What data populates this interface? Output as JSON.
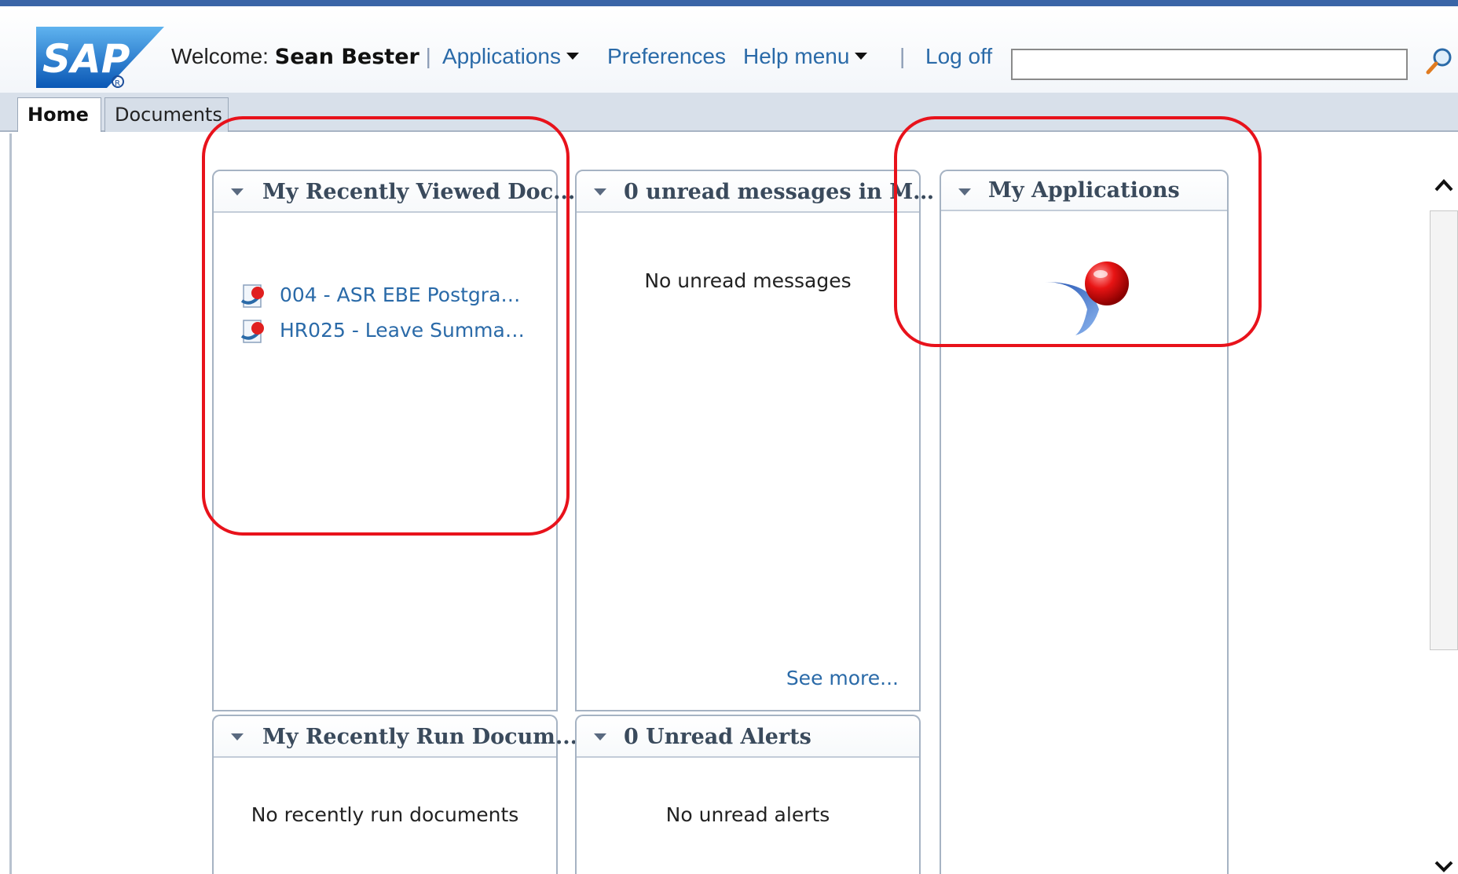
{
  "header": {
    "logo_text": "SAP",
    "welcome_label": "Welcome:",
    "user_name": "Sean Bester",
    "separator": "|",
    "applications_label": "Applications",
    "preferences_label": "Preferences",
    "help_menu_label": "Help menu",
    "logoff_label": "Log off",
    "search_value": "",
    "search_icon": "magnifier-icon"
  },
  "tabs": [
    {
      "label": "Home",
      "selected": true
    },
    {
      "label": "Documents",
      "selected": false
    }
  ],
  "panels": {
    "recent_viewed": {
      "title": "My Recently Viewed Doc...",
      "items": [
        {
          "label": "004 - ASR EBE Postgra…",
          "icon": "crystal-report-icon"
        },
        {
          "label": "HR025 - Leave Summa…",
          "icon": "crystal-report-icon"
        }
      ]
    },
    "messages": {
      "title": "0 unread messages in M…",
      "empty_text": "No unread messages",
      "see_more": "See more..."
    },
    "applications": {
      "title": "My Applications",
      "icon": "application-icon"
    },
    "recent_run": {
      "title": "My Recently Run Docum...",
      "empty_text": "No recently run documents"
    },
    "alerts": {
      "title": "0 Unread Alerts",
      "empty_text": "No unread alerts"
    }
  },
  "colors": {
    "link": "#2a6aa8",
    "annotation": "#e8121b",
    "top_bar": "#3a65a7"
  }
}
